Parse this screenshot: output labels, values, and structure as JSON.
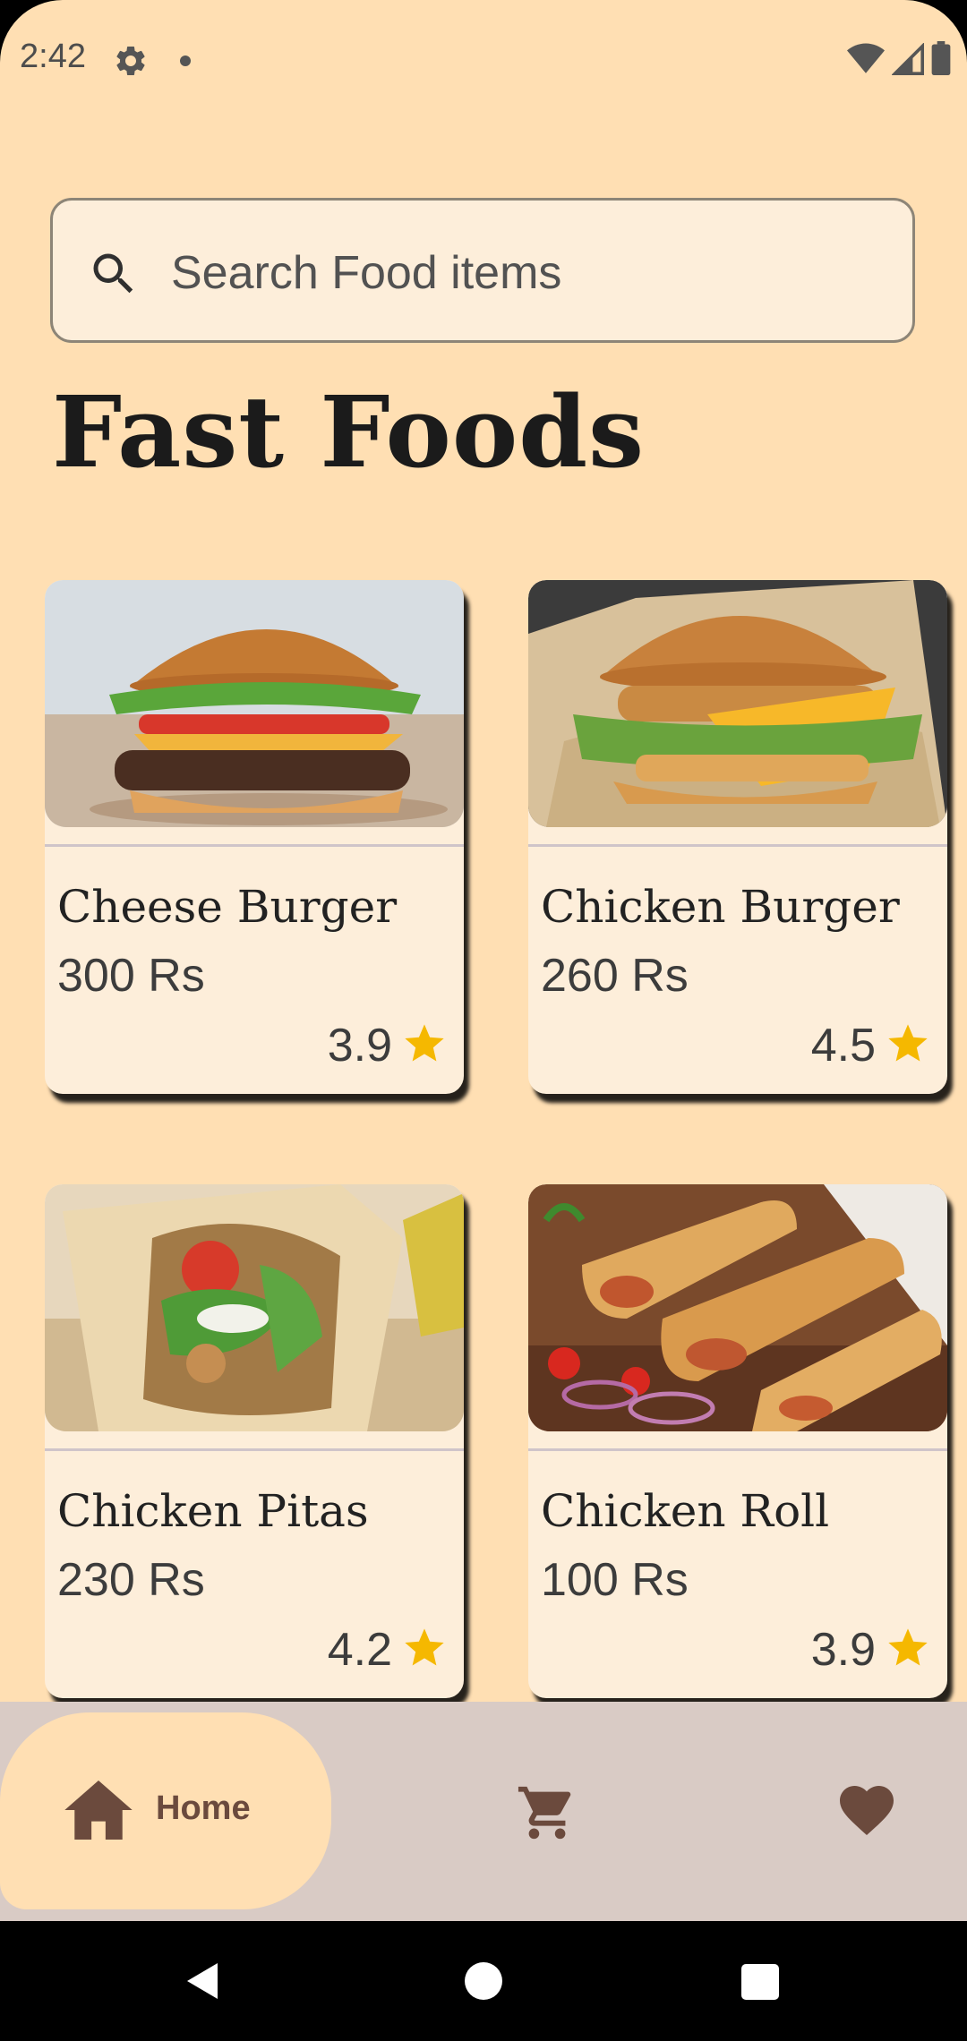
{
  "status_bar": {
    "time": "2:42",
    "icons": [
      "gear-icon",
      "notification-dot-icon",
      "wifi-icon",
      "signal-icon",
      "battery-icon"
    ]
  },
  "search": {
    "placeholder": "Search Food items",
    "icon": "search-icon"
  },
  "page": {
    "title": "Fast Foods"
  },
  "items": [
    {
      "name": "Cheese Burger",
      "price": "300 Rs",
      "rating": "3.9",
      "image": "cheese-burger-photo"
    },
    {
      "name": "Chicken Burger",
      "price": "260 Rs",
      "rating": "4.5",
      "image": "chicken-burger-photo"
    },
    {
      "name": "Chicken Pitas",
      "price": "230 Rs",
      "rating": "4.2",
      "image": "chicken-pitas-photo"
    },
    {
      "name": "Chicken Roll",
      "price": "100 Rs",
      "rating": "3.9",
      "image": "chicken-roll-photo"
    }
  ],
  "bottom_nav": {
    "home_label": "Home",
    "active": "home",
    "icons": [
      "home-icon",
      "cart-icon",
      "heart-icon"
    ]
  },
  "colors": {
    "background": "#FFDFB3",
    "card": "#FDEEDA",
    "nav_bar": "#D9CBC5",
    "nav_icon": "#6B4A3D",
    "star": "#F5B800"
  }
}
